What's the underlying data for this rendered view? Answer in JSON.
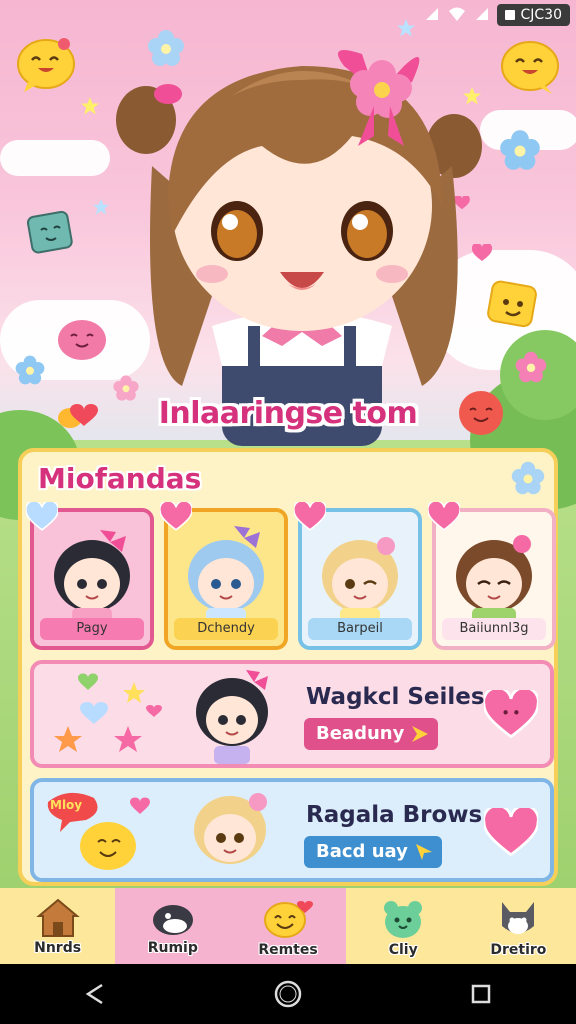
{
  "status_bar": {
    "time": "CJC30"
  },
  "hero": {
    "title": "Inlaaringse tom"
  },
  "panel": {
    "title": "Miofandas",
    "cards": [
      {
        "label": "Pagy"
      },
      {
        "label": "Dchendy"
      },
      {
        "label": "Barpeil"
      },
      {
        "label": "Baiiunnl3g"
      }
    ],
    "banners": [
      {
        "title": "Wagkcl Seiles",
        "button": "Beaduny"
      },
      {
        "title": "Ragala Brows",
        "button": "Bacd uay",
        "sticker_text": "Mloy"
      }
    ]
  },
  "tabs": [
    {
      "label": "Nnrds",
      "icon": "house-icon"
    },
    {
      "label": "Rumip",
      "icon": "orca-icon"
    },
    {
      "label": "Remtes",
      "icon": "smiley-icon"
    },
    {
      "label": "Cliy",
      "icon": "bear-icon"
    },
    {
      "label": "Dretiro",
      "icon": "cat-icon"
    }
  ],
  "colors": {
    "accent": "#d6317c",
    "panel_bg": "#fdf3c6",
    "panel_border": "#f6cf59",
    "banner1_button": "#e0508a",
    "banner2_button": "#3d8fcf"
  }
}
